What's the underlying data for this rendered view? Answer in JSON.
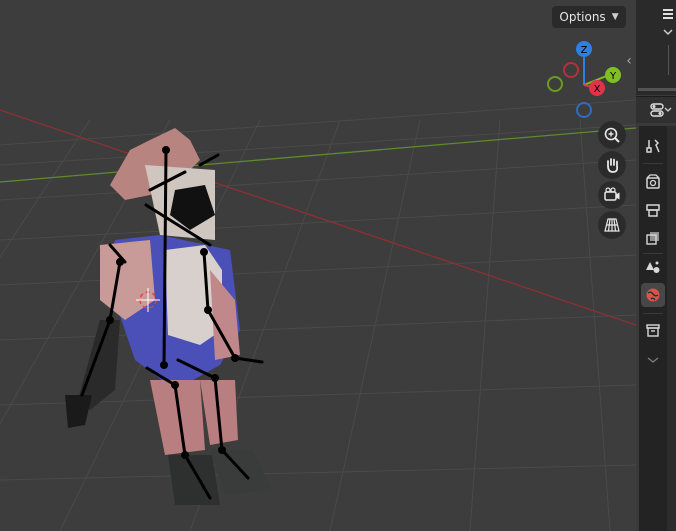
{
  "viewport": {
    "options_label": "Options",
    "background_color": "#3d3d3d",
    "x_axis_color": "#8f2f33",
    "y_axis_color": "#5f8a2d"
  },
  "gizmo": {
    "z_label": "Z",
    "x_label": "X",
    "y_label": "Y",
    "z_color": "#2f7fe0",
    "x_color": "#e0334a",
    "y_color": "#7fbf23"
  },
  "nav_buttons": [
    {
      "name": "zoom-icon"
    },
    {
      "name": "hand-pan-icon"
    },
    {
      "name": "camera-view-icon"
    },
    {
      "name": "perspective-grid-icon"
    }
  ],
  "property_tabs": [
    {
      "name": "tool-icon"
    },
    {
      "name": "render-icon"
    },
    {
      "name": "output-icon"
    },
    {
      "name": "view-layer-icon"
    },
    {
      "name": "scene-icon"
    },
    {
      "name": "world-icon",
      "active": true
    },
    {
      "name": "collection-icon"
    }
  ]
}
